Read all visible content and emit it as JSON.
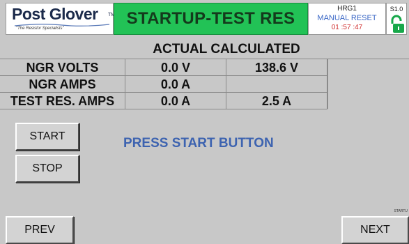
{
  "header": {
    "logo_text": "Post Glover",
    "logo_tm": "TM",
    "logo_tagline": "\"The Resistor Specialists\"",
    "title": "STARTUP-TEST RES",
    "status": {
      "device": "HRG1",
      "mode": "MANUAL RESET",
      "timer": "01 :57 :47"
    },
    "version": "S1.0",
    "lock_icon": "unlocked-padlock-icon",
    "title_color": "#22c256"
  },
  "table": {
    "headers": [
      "ACTUAL",
      "CALCULATED"
    ],
    "rows": [
      {
        "label": "NGR VOLTS",
        "actual": "0.0 V",
        "calculated": "138.6 V"
      },
      {
        "label": "NGR AMPS",
        "actual": "0.0 A",
        "calculated": ""
      },
      {
        "label": "TEST RES. AMPS",
        "actual": "0.0 A",
        "calculated": "2.5 A"
      }
    ]
  },
  "controls": {
    "start_label": "START",
    "stop_label": "STOP",
    "message": "PRESS START BUTTON"
  },
  "nav": {
    "prev_label": "PREV",
    "next_label": "NEXT",
    "screen_id": "STARTU"
  }
}
